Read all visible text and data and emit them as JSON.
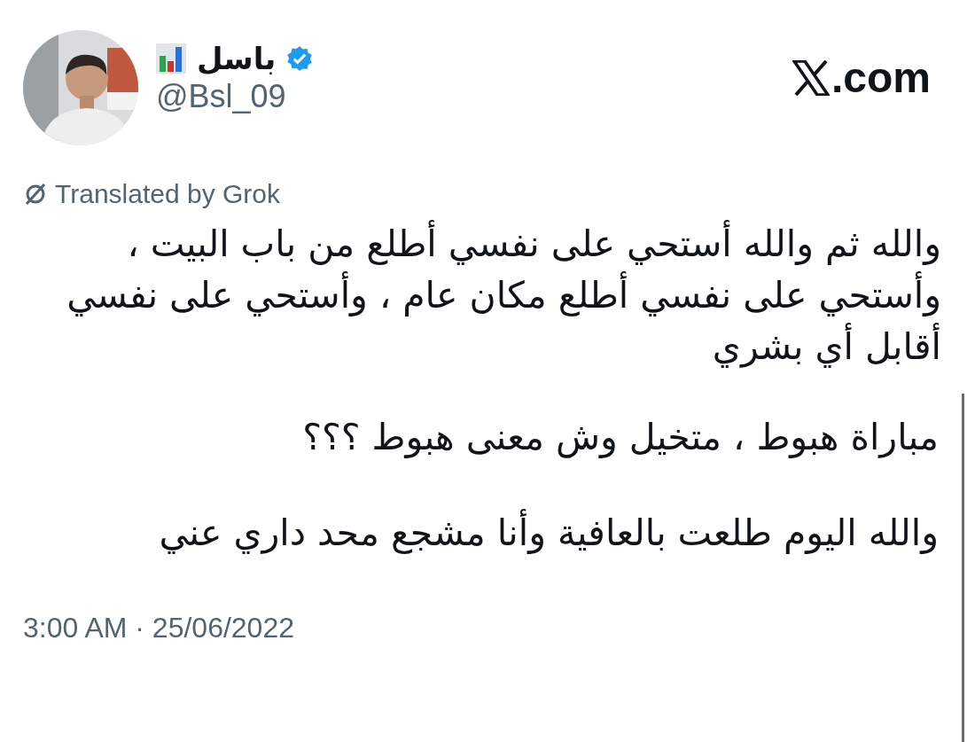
{
  "author": {
    "name": "باسل",
    "handle": "@Bsl_09",
    "verified": true
  },
  "site": {
    "suffix": ".com"
  },
  "translation_note": "Translated by Grok",
  "paragraphs": [
    "والله ثم والله أستحي على نفسي أطلع من باب البيت ،\nوأستحي على نفسي أطلع مكان عام ، وأستحي على نفسي\nأقابل أي بشري",
    "مباراة هبوط ، متخيل وش معنى هبوط ؟؟؟",
    "والله اليوم طلعت بالعافية وأنا مشجع محد داري عني"
  ],
  "timestamp": "3:00 AM · 25/06/2022"
}
